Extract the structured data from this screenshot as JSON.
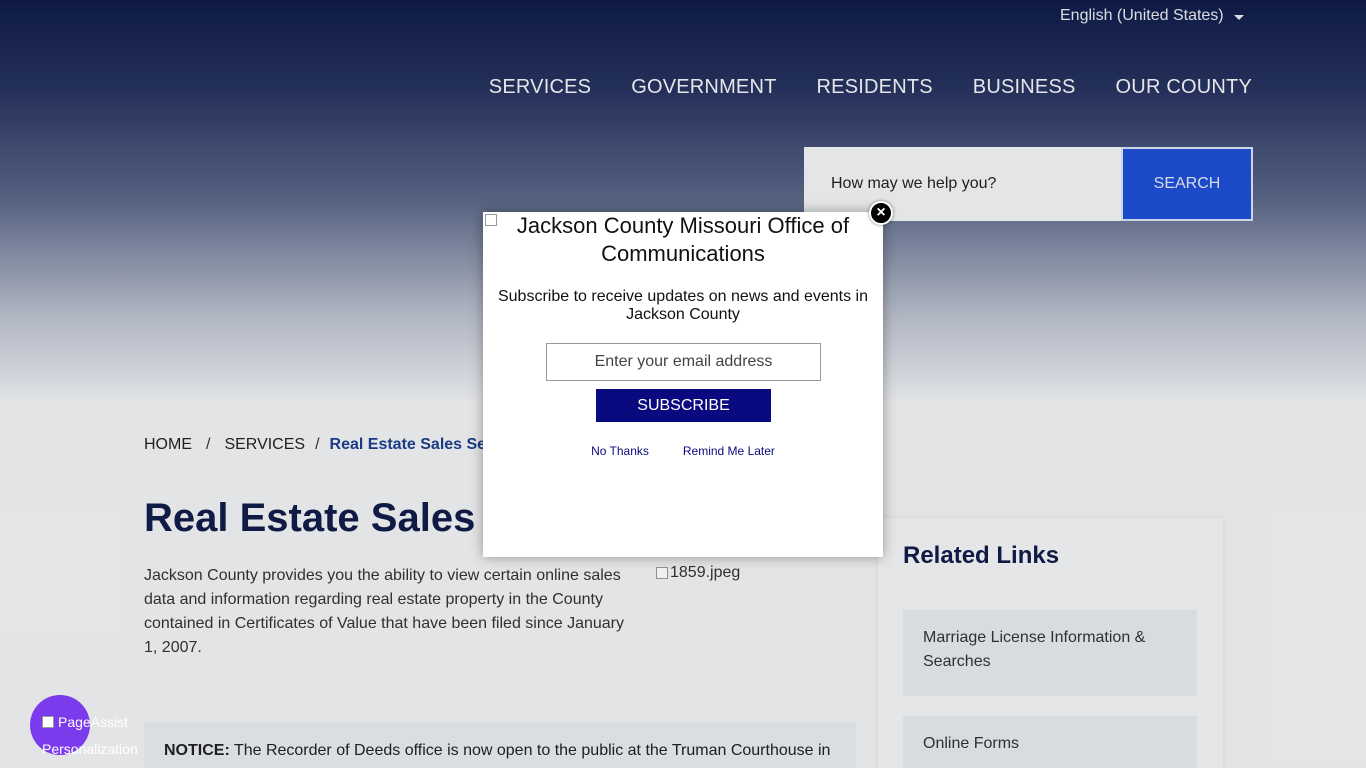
{
  "header": {
    "language": "English (United States)",
    "nav": [
      "SERVICES",
      "GOVERNMENT",
      "RESIDENTS",
      "BUSINESS",
      "OUR COUNTY"
    ],
    "search": {
      "placeholder": "How may we help you?",
      "button": "SEARCH"
    }
  },
  "breadcrumb": {
    "home": "HOME",
    "sep": "/",
    "services": "SERVICES",
    "current": "Real Estate Sales Se"
  },
  "page": {
    "title": "Real Estate Sales",
    "intro": "Jackson County provides you the ability to view certain online sales data and information regarding real estate property in the County contained in Certificates of Value that have been filed since January 1, 2007.",
    "image_alt": "1859.jpeg",
    "notice_label": "NOTICE:",
    "notice_text": " The Recorder of Deeds office is now open to the public at the Truman Courthouse in"
  },
  "related": {
    "title": "Related Links",
    "items": [
      "Marriage License Information & Searches",
      "Online Forms"
    ]
  },
  "pageassist": {
    "line1": "PageAssist",
    "line2": "Personalization",
    "color": "#7c3aed"
  },
  "modal": {
    "logo_alt": "Jackson County Missouri Office of Communications",
    "description": "Subscribe to receive updates on news and events in Jackson County",
    "email_placeholder": "Enter your email address",
    "subscribe": "SUBSCRIBE",
    "no_thanks": "No Thanks",
    "remind_later": "Remind Me Later",
    "close": "×"
  }
}
